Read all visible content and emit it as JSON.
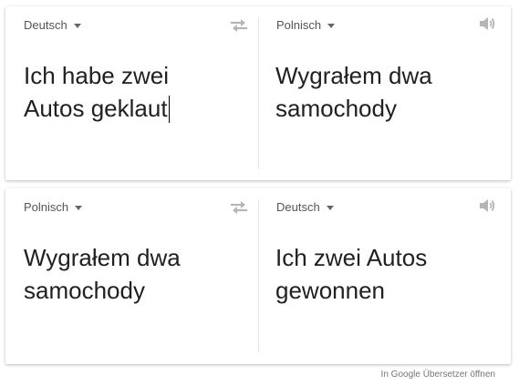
{
  "card_top": {
    "source_language": "Deutsch",
    "source_text_line1": "Ich habe zwei",
    "source_text_line2": "Autos geklaut",
    "target_language": "Polnisch",
    "target_text_line1": "Wygrałem dwa",
    "target_text_line2": "samochody"
  },
  "card_bottom": {
    "source_language": "Polnisch",
    "source_text_line1": "Wygrałem dwa",
    "source_text_line2": "samochody",
    "target_language": "Deutsch",
    "target_text_line1": "Ich zwei Autos",
    "target_text_line2": "gewonnen"
  },
  "footer": {
    "open_link": "In Google Übersetzer öffnen"
  },
  "icons": {
    "swap": "swap-languages-icon",
    "speaker": "speaker-icon",
    "dropdown": "chevron-down-icon"
  },
  "colors": {
    "card_background": "#ffffff",
    "text": "#212121",
    "label": "#555555",
    "icon": "#b5b5b5",
    "link": "#777777"
  }
}
